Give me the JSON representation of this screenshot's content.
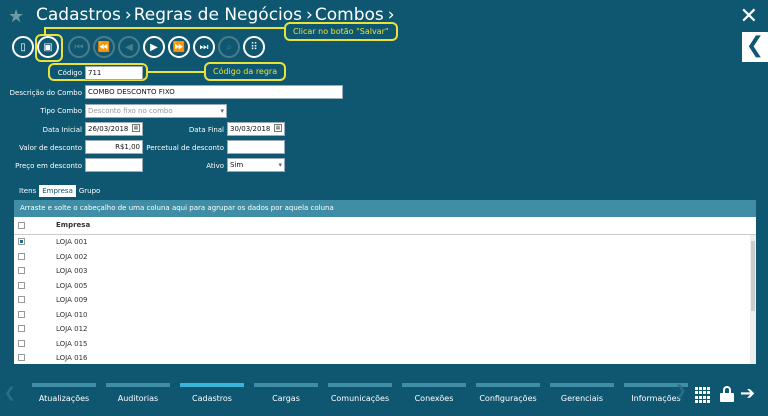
{
  "breadcrumb": [
    "Cadastros",
    "Regras de Negócios",
    "Combos"
  ],
  "callouts": {
    "save": "Clicar no botão \"Salvar\"",
    "code": "Código da regra"
  },
  "form": {
    "codigo_label": "Código",
    "codigo_value": "711",
    "descricao_label": "Descrição do Combo",
    "descricao_value": "COMBO DESCONTO FIXO",
    "tipo_label": "Tipo Combo",
    "tipo_value": "Desconto fixo no combo",
    "data_inicial_label": "Data Inicial",
    "data_inicial_value": "26/03/2018",
    "data_final_label": "Data Final",
    "data_final_value": "30/03/2018",
    "valor_desconto_label": "Valor de desconto",
    "valor_desconto_value": "R$1,00",
    "percentual_label": "Percetual de desconto",
    "percentual_value": "",
    "preco_label": "Preço em desconto",
    "preco_value": "",
    "ativo_label": "Ativo",
    "ativo_value": "Sim"
  },
  "tabs": [
    "Itens",
    "Empresa",
    "Grupo"
  ],
  "grid": {
    "group_hint": "Arraste e solte o cabeçalho de uma coluna aqui para agrupar os dados por aquela coluna",
    "column": "Empresa",
    "rows": [
      {
        "name": "LOJA 001",
        "checked": true
      },
      {
        "name": "LOJA 002",
        "checked": false
      },
      {
        "name": "LOJA 003",
        "checked": false
      },
      {
        "name": "LOJA 005",
        "checked": false
      },
      {
        "name": "LOJA 009",
        "checked": false
      },
      {
        "name": "LOJA 010",
        "checked": false
      },
      {
        "name": "LOJA 012",
        "checked": false
      },
      {
        "name": "LOJA 015",
        "checked": false
      },
      {
        "name": "LOJA 016",
        "checked": false
      }
    ]
  },
  "bottom_nav": [
    "Atualizações",
    "Auditorias",
    "Cadastros",
    "Cargas",
    "Comunicações",
    "Conexões",
    "Configurações",
    "Gerenciais",
    "Informações"
  ],
  "bottom_nav_active": "Cadastros"
}
